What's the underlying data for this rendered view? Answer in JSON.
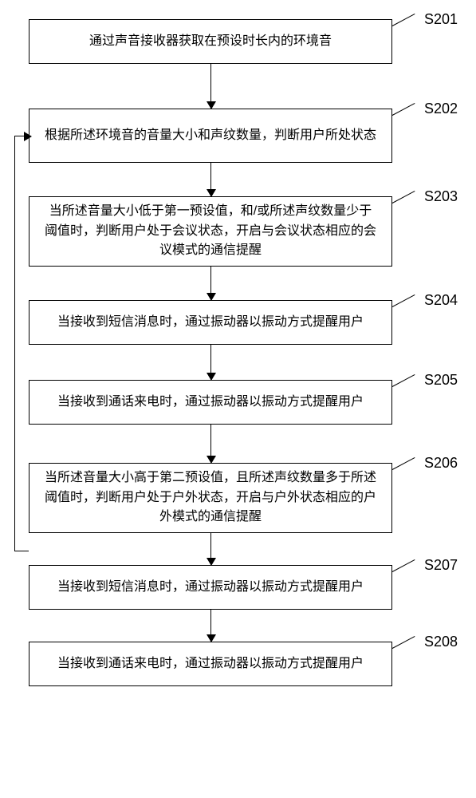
{
  "flowchart": {
    "nodes": [
      {
        "id": "S201",
        "label": "S201",
        "text": "通过声音接收器获取在预设时长内的环境音"
      },
      {
        "id": "S202",
        "label": "S202",
        "text": "根据所述环境音的音量大小和声纹数量，判断用户所处状态"
      },
      {
        "id": "S203",
        "label": "S203",
        "text": "当所述音量大小低于第一预设值，和/或所述声纹数量少于阈值时，判断用户处于会议状态，开启与会议状态相应的会议模式的通信提醒"
      },
      {
        "id": "S204",
        "label": "S204",
        "text": "当接收到短信消息时，通过振动器以振动方式提醒用户"
      },
      {
        "id": "S205",
        "label": "S205",
        "text": "当接收到通话来电时，通过振动器以振动方式提醒用户"
      },
      {
        "id": "S206",
        "label": "S206",
        "text": "当所述音量大小高于第二预设值，且所述声纹数量多于所述阈值时，判断用户处于户外状态，开启与户外状态相应的户外模式的通信提醒"
      },
      {
        "id": "S207",
        "label": "S207",
        "text": "当接收到短信消息时，通过振动器以振动方式提醒用户"
      },
      {
        "id": "S208",
        "label": "S208",
        "text": "当接收到通话来电时，通过振动器以振动方式提醒用户"
      }
    ],
    "loop": {
      "from": "S206",
      "to": "S202"
    }
  }
}
